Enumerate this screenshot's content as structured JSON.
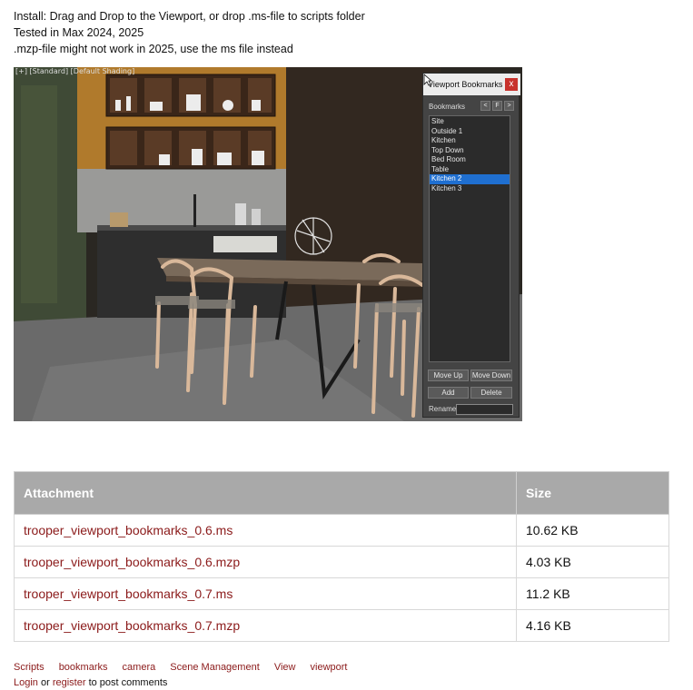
{
  "intro": {
    "line1": "Install: Drag and Drop to the Viewport, or drop .ms-file to scripts folder",
    "line2": "Tested in Max 2024, 2025",
    "line3": ".mzp-file might not work in 2025, use the ms file instead"
  },
  "viewport": {
    "label": "[+] [Standard] [Default Shading]"
  },
  "bookmarks_panel": {
    "title": "Viewport Bookmarks",
    "close": "x",
    "header": "Bookmarks",
    "nav": [
      "<",
      "F",
      ">"
    ],
    "items": [
      "Site",
      "Outside 1",
      "Kitchen",
      "Top Down",
      "Bed Room",
      "Table",
      "Kitchen 2",
      "Kitchen 3"
    ],
    "selected_item": "Kitchen 2",
    "move_up": "Move Up",
    "move_down": "Move Down",
    "add": "Add",
    "delete": "Delete",
    "rename_label": "Rename"
  },
  "attachments": {
    "headers": [
      "Attachment",
      "Size"
    ],
    "rows": [
      {
        "name": "trooper_viewport_bookmarks_0.6.ms",
        "size": "10.62 KB"
      },
      {
        "name": "trooper_viewport_bookmarks_0.6.mzp",
        "size": "4.03 KB"
      },
      {
        "name": "trooper_viewport_bookmarks_0.7.ms",
        "size": "11.2 KB"
      },
      {
        "name": "trooper_viewport_bookmarks_0.7.mzp",
        "size": "4.16 KB"
      }
    ]
  },
  "tags": [
    "Scripts",
    "bookmarks",
    "camera",
    "Scene Management",
    "View",
    "viewport"
  ],
  "comments": {
    "login": "Login",
    "or": " or ",
    "register": "register",
    "suffix": " to post comments"
  },
  "colors": {
    "link": "#8b1a1a",
    "table_header": "#a9a9a9",
    "selection": "#1f6fd0",
    "close_button": "#c8322c"
  }
}
